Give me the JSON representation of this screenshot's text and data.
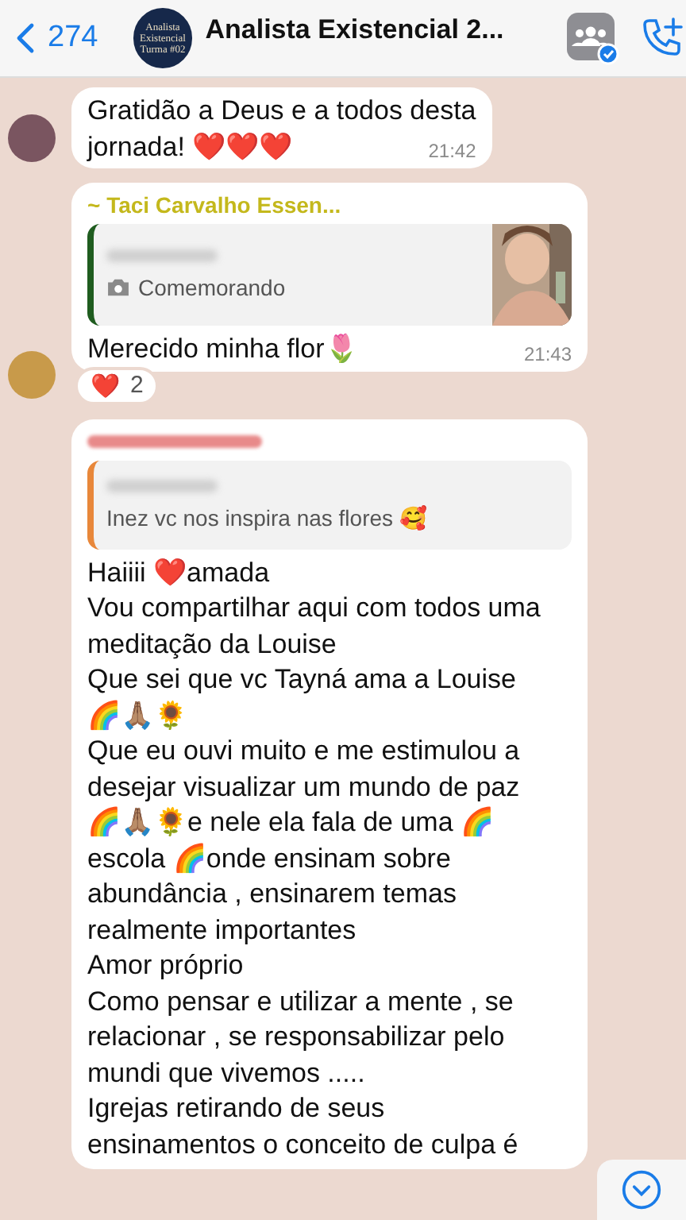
{
  "header": {
    "back_count": "274",
    "logo_text": "Analista Existencial Turma #02",
    "title": "Analista Existencial 2..."
  },
  "messages": [
    {
      "kind": "text",
      "lines": [
        "Gratidão a Deus e a todos desta",
        "jornada! ❤️❤️❤️"
      ],
      "time": "21:42"
    },
    {
      "kind": "reply",
      "sender": "~ Taci Carvalho Essen...",
      "color": "#c4b81c",
      "quote": {
        "color": "#1f5c1f",
        "text": "Comemorando"
      },
      "lines": [
        "Merecido minha flor🌷"
      ],
      "time": "21:43",
      "reactions": [
        {
          "emoji": "❤️",
          "count": "2"
        }
      ]
    },
    {
      "kind": "reply",
      "color": "#e88a8a",
      "quote": {
        "kind": "text",
        "color": "#e8873a",
        "text": "Inez vc nos inspira nas flores 🥰"
      },
      "lines": [
        "Haiiii ❤️amada",
        "Vou compartilhar aqui com todos uma",
        "meditação da Louise",
        "Que sei que vc Tayná ama a Louise",
        "🌈🙏🏽🌻",
        "Que eu ouvi muito e me estimulou a",
        "desejar visualizar  um mundo de paz",
        "🌈🙏🏽🌻e nele ela fala de uma 🌈",
        "escola 🌈onde ensinam sobre",
        "abundância , ensinarem temas",
        "realmente importantes",
        "Amor próprio",
        "Como pensar e utilizar a mente , se",
        "relacionar , se responsabilizar pelo",
        "mundi que vivemos .....",
        "Igrejas retirando de seus",
        "ensinamentos o conceito de culpa é"
      ]
    }
  ]
}
